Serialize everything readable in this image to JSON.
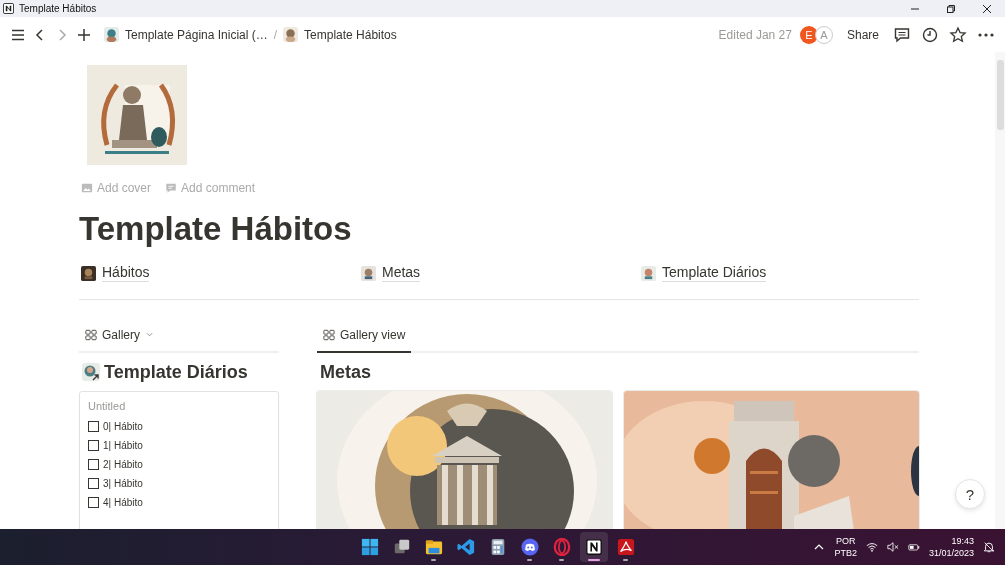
{
  "window": {
    "title": "Template Hábitos"
  },
  "topbar": {
    "breadcrumbs": [
      {
        "label": "Template Página Inicial (…"
      },
      {
        "label": "Template Hábitos"
      }
    ],
    "separator": "/",
    "edited": "Edited Jan 27",
    "avatars": [
      {
        "initial": "E",
        "color": "#f0561d"
      },
      {
        "initial": "A",
        "color": "#ffffff"
      }
    ],
    "share": "Share"
  },
  "page": {
    "actions": [
      "Add cover",
      "Add comment"
    ],
    "title": "Template Hábitos",
    "links": [
      {
        "label": "Hábitos"
      },
      {
        "label": "Metas"
      },
      {
        "label": "Template Diários"
      }
    ]
  },
  "left_view": {
    "view_menu": "Gallery",
    "heading": "Template Diários",
    "card": {
      "title": "Untitled",
      "items": [
        {
          "label": "0| Hábito",
          "checked": false
        },
        {
          "label": "1| Hábito",
          "checked": false
        },
        {
          "label": "2| Hábito",
          "checked": false
        },
        {
          "label": "3| Hábito",
          "checked": false
        },
        {
          "label": "4| Hábito",
          "checked": false
        }
      ]
    }
  },
  "right_view": {
    "tabs": [
      {
        "label": "Gallery view",
        "selected": true
      }
    ],
    "heading": "Metas"
  },
  "help": "?",
  "taskbar": {
    "apps": [
      {
        "kind": "start",
        "running": false,
        "active": false
      },
      {
        "kind": "taskview",
        "running": false,
        "active": false
      },
      {
        "kind": "explorer",
        "running": true,
        "active": false
      },
      {
        "kind": "vscode",
        "running": false,
        "active": false
      },
      {
        "kind": "calculator",
        "running": false,
        "active": false
      },
      {
        "kind": "discord",
        "running": true,
        "active": false
      },
      {
        "kind": "opera",
        "running": true,
        "active": false
      },
      {
        "kind": "notion",
        "running": true,
        "active": true
      },
      {
        "kind": "acrobat",
        "running": true,
        "active": false
      }
    ],
    "tray": {
      "language": "POR",
      "layout": "PTB2",
      "time": "19:43",
      "date": "31/01/2023"
    }
  }
}
